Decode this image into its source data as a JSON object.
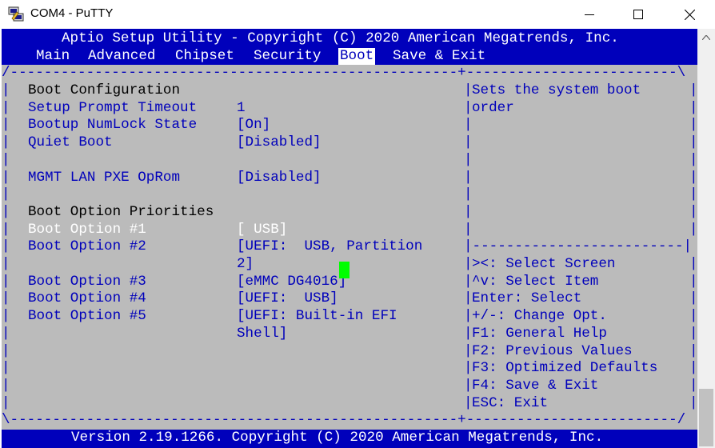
{
  "window": {
    "title": "COM4 - PuTTY",
    "icons": [
      "putty-icon",
      "minimize-icon",
      "maximize-icon",
      "close-icon"
    ]
  },
  "bios": {
    "header_title": "Aptio Setup Utility - Copyright (C) 2020 American Megatrends, Inc.",
    "menu_tabs": [
      {
        "label": "Main",
        "active": false
      },
      {
        "label": "Advanced",
        "active": false
      },
      {
        "label": "Chipset",
        "active": false
      },
      {
        "label": "Security",
        "active": false
      },
      {
        "label": "Boot",
        "active": true
      },
      {
        "label": "Save & Exit",
        "active": false
      }
    ],
    "section_boot_config": "Boot Configuration",
    "settings": [
      {
        "label": "Setup Prompt Timeout",
        "value": "1"
      },
      {
        "label": "Bootup NumLock State",
        "value": "[On]"
      },
      {
        "label": "Quiet Boot",
        "value": "[Disabled]"
      },
      {
        "label": "MGMT LAN PXE OpRom",
        "value": "[Disabled]"
      }
    ],
    "section_priorities": "Boot Option Priorities",
    "boot_options": [
      {
        "label": "Boot Option #1",
        "value": "[ USB]",
        "selected": true
      },
      {
        "label": "Boot Option #2",
        "value": "[UEFI:  USB, Partition",
        "value_cont": "2]"
      },
      {
        "label": "Boot Option #3",
        "value": "[eMMC DG4016]"
      },
      {
        "label": "Boot Option #4",
        "value": "[UEFI:  USB]"
      },
      {
        "label": "Boot Option #5",
        "value": "[UEFI: Built-in EFI",
        "value_cont": "Shell]"
      }
    ],
    "help_text": [
      "Sets the system boot",
      "order"
    ],
    "key_help": [
      "><: Select Screen",
      "^v: Select Item",
      "Enter: Select",
      "+/-: Change Opt.",
      "F1: General Help",
      "F2: Previous Values",
      "F3: Optimized Defaults",
      "F4: Save & Exit",
      "ESC: Exit"
    ],
    "footer": "Version 2.19.1266. Copyright (C) 2020 American Megatrends, Inc.",
    "cursor_color": "#00ff00",
    "bar_color": "#0000bb",
    "background_color": "#bbbbbb"
  }
}
